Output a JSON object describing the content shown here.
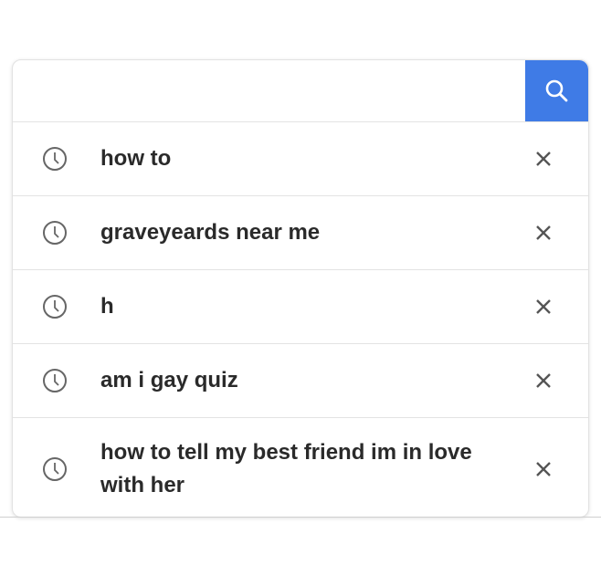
{
  "search": {
    "value": "",
    "placeholder": "",
    "button_icon": "search-icon",
    "accent": "#3f7be6"
  },
  "history": [
    {
      "text": "how to",
      "icon": "clock-icon"
    },
    {
      "text": "graveyeards near me",
      "icon": "clock-icon"
    },
    {
      "text": "h",
      "icon": "clock-icon"
    },
    {
      "text": "am i gay quiz",
      "icon": "clock-icon"
    },
    {
      "text": "how to tell my best friend im in love with her",
      "icon": "clock-icon"
    }
  ]
}
